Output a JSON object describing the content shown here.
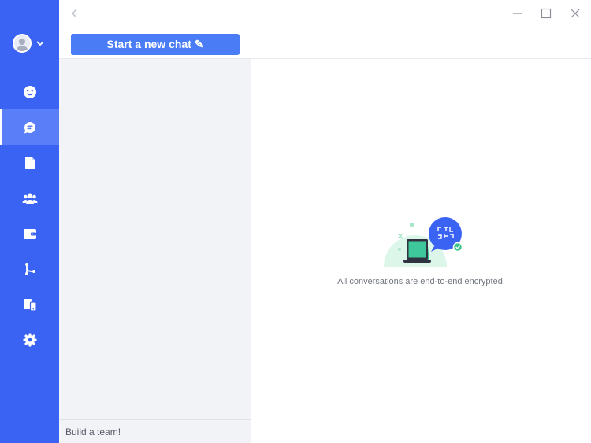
{
  "topbar": {
    "new_chat_label": "Start a new chat ✎"
  },
  "sidebar": {
    "items": [
      {
        "icon": "smiley-icon",
        "active": false
      },
      {
        "icon": "chat-bubble-icon",
        "active": true
      },
      {
        "icon": "document-icon",
        "active": false
      },
      {
        "icon": "team-icon",
        "active": false
      },
      {
        "icon": "wallet-icon",
        "active": false
      },
      {
        "icon": "branch-icon",
        "active": false
      },
      {
        "icon": "devices-icon",
        "active": false
      },
      {
        "icon": "gear-icon",
        "active": false
      }
    ]
  },
  "conversation_list": {
    "footer_text": "Build a team!"
  },
  "main": {
    "encryption_message": "All conversations are end-to-end encrypted."
  },
  "colors": {
    "rail": "#3b63f3",
    "rail_active": "#5a7ef7",
    "accent_button": "#4a7cf6",
    "list_bg": "#f2f3f6",
    "badge_green": "#3cc48a"
  }
}
